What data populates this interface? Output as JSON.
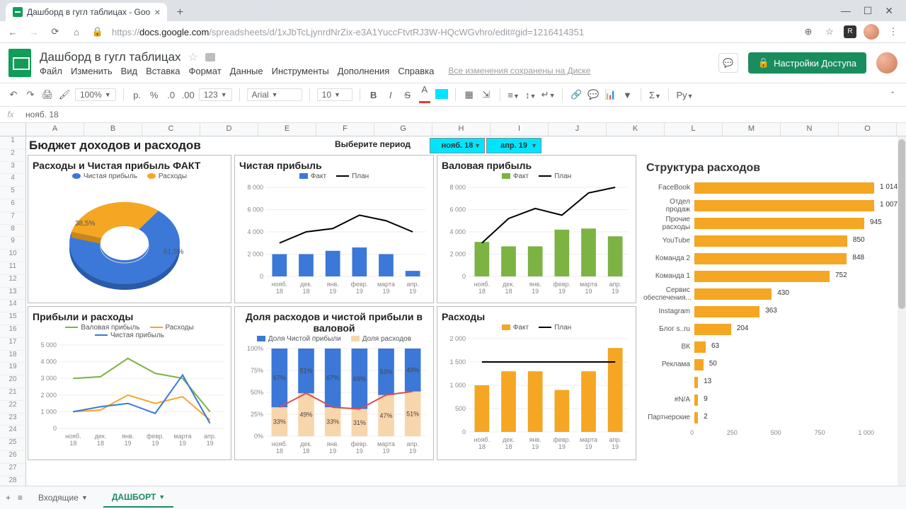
{
  "browser": {
    "tab_title": "Дашборд в гугл таблицах - Goo",
    "new_tab": "+",
    "url_prefix": "https://",
    "url_host": "docs.google.com",
    "url_path": "/spreadsheets/d/1xJbTcLjynrdNrZix-e3A1YuccFtvtRJ3W-HQcWGvhro/edit#gid=1216414351"
  },
  "doc": {
    "title": "Дашборд в гугл таблицах",
    "share": "Настройки Доступа",
    "save_indicator": "Все изменения сохранены на Диске",
    "menu": [
      "Файл",
      "Изменить",
      "Вид",
      "Вставка",
      "Формат",
      "Данные",
      "Инструменты",
      "Дополнения",
      "Справка"
    ]
  },
  "toolbar": {
    "zoom": "100%",
    "currency": "р.",
    "percent": "%",
    "dec_remove": ".0",
    "dec_add": ".00",
    "num_fmt": "123",
    "font": "Arial",
    "font_size": "10",
    "bold": "B",
    "italic": "I",
    "strike": "S",
    "text_color": "A",
    "fill": "▇",
    "script": "Ру"
  },
  "fx": {
    "value": "нояб. 18"
  },
  "columns": [
    "A",
    "B",
    "C",
    "D",
    "E",
    "F",
    "G",
    "H",
    "I",
    "J",
    "K",
    "L",
    "M",
    "N",
    "O"
  ],
  "rows_max": 28,
  "dashboard": {
    "title": "Бюджет доходов и расходов",
    "period_label": "Выберите период",
    "period_from": "нояб. 18",
    "period_to": "апр. 19",
    "categories": [
      "нояб. 18",
      "дек. 18",
      "янв. 19",
      "февр. 19",
      "марта 19",
      "апр. 19"
    ]
  },
  "panels": {
    "donut_title": "Расходы и Чистая прибыль ФАКТ",
    "donut_legend_a": "Чистая прибыль",
    "donut_legend_b": "Расходы",
    "net_title": "Чистая прибыль",
    "gross_title": "Валовая прибыль",
    "legend_fact": "Факт",
    "legend_plan": "План",
    "pl_title": "Прибыли и расходы",
    "pl_legend_gross": "Валовая прибыль",
    "pl_legend_exp": "Расходы",
    "pl_legend_net": "Чистая прибыль",
    "share_title": "Доля расходов и чистой прибыли в валовой",
    "share_legend_net": "Доля Чистой прибыли",
    "share_legend_exp": "Доля расходов",
    "exp_title": "Расходы",
    "struct_title": "Структура расходов"
  },
  "sheet_tabs": {
    "add": "+",
    "all": "≡",
    "tab1": "Входящие",
    "tab2": "ДАШБОРТ"
  },
  "chart_data": [
    {
      "id": "donut",
      "type": "pie",
      "title": "Расходы и Чистая прибыль ФАКТ",
      "series": [
        {
          "name": "Чистая прибыль",
          "value": 61.5,
          "color": "#3b78d8"
        },
        {
          "name": "Расходы",
          "value": 38.5,
          "color": "#f5a623"
        }
      ],
      "labels": [
        "61,5%",
        "38,5%"
      ]
    },
    {
      "id": "net_profit",
      "type": "bar",
      "title": "Чистая прибыль",
      "categories": [
        "нояб. 18",
        "дек. 18",
        "янв. 19",
        "февр. 19",
        "марта 19",
        "апр. 19"
      ],
      "series": [
        {
          "name": "Факт",
          "color": "#3b78d8",
          "values": [
            2000,
            2000,
            2300,
            2600,
            2000,
            500
          ]
        },
        {
          "name": "План",
          "color": "#000",
          "type": "line",
          "values": [
            3000,
            4000,
            4300,
            5500,
            5000,
            4000
          ]
        }
      ],
      "ylabel": "",
      "ylim": [
        0,
        8000
      ],
      "yticks": [
        0,
        2000,
        4000,
        6000,
        8000
      ]
    },
    {
      "id": "gross_profit",
      "type": "bar",
      "title": "Валовая прибыль",
      "categories": [
        "нояб. 18",
        "дек. 18",
        "янв. 19",
        "февр. 19",
        "марта 19",
        "апр. 19"
      ],
      "series": [
        {
          "name": "Факт",
          "color": "#7cb342",
          "values": [
            3100,
            2700,
            2700,
            4200,
            4300,
            3600
          ]
        },
        {
          "name": "План",
          "color": "#000",
          "type": "line",
          "values": [
            3000,
            5200,
            6100,
            5500,
            7500,
            8000
          ]
        }
      ],
      "ylim": [
        0,
        8000
      ],
      "yticks": [
        0,
        2000,
        4000,
        6000,
        8000
      ]
    },
    {
      "id": "pl_lines",
      "type": "line",
      "title": "Прибыли и расходы",
      "categories": [
        "нояб. 18",
        "дек. 18",
        "янв. 19",
        "февр. 19",
        "марта 19",
        "апр. 19"
      ],
      "series": [
        {
          "name": "Валовая прибыль",
          "color": "#7cb342",
          "values": [
            3000,
            3100,
            4200,
            3300,
            3000,
            1000
          ]
        },
        {
          "name": "Расходы",
          "color": "#f5a623",
          "values": [
            1000,
            1100,
            2000,
            1500,
            1900,
            500
          ]
        },
        {
          "name": "Чистая прибыль",
          "color": "#3b78d8",
          "values": [
            1000,
            1300,
            1500,
            900,
            3200,
            300
          ]
        }
      ],
      "ylim": [
        0,
        5000
      ],
      "yticks": [
        0,
        1000,
        2000,
        3000,
        4000,
        5000
      ]
    },
    {
      "id": "share_stack",
      "type": "bar",
      "stacked": true,
      "title": "Доля расходов и чистой прибыли в валовой",
      "categories": [
        "нояб. 18",
        "дек. 18",
        "янв. 19",
        "февр. 19",
        "марта 19",
        "апр. 19"
      ],
      "series": [
        {
          "name": "Доля Чистой прибыли",
          "color": "#3b78d8",
          "values": [
            67,
            51,
            67,
            69,
            53,
            49
          ]
        },
        {
          "name": "Доля расходов",
          "color": "#f8d6ab",
          "values": [
            33,
            49,
            33,
            31,
            47,
            51
          ]
        }
      ],
      "ylim": [
        0,
        100
      ],
      "yticks": [
        0,
        25,
        50,
        75,
        100
      ],
      "yformat": "%",
      "series_labels": [
        [
          67,
          51,
          67,
          69,
          53,
          49
        ],
        [
          33,
          49,
          33,
          31,
          47,
          51
        ]
      ],
      "trend_line": {
        "color": "#d94f4f",
        "values": [
          33,
          49,
          33,
          31,
          47,
          51
        ]
      }
    },
    {
      "id": "expenses_bar",
      "type": "bar",
      "title": "Расходы",
      "categories": [
        "нояб. 18",
        "дек. 18",
        "янв. 19",
        "февр. 19",
        "марта 19",
        "апр. 19"
      ],
      "series": [
        {
          "name": "Факт",
          "color": "#f5a623",
          "values": [
            1000,
            1300,
            1300,
            900,
            1300,
            1800
          ]
        },
        {
          "name": "План",
          "color": "#000",
          "type": "line",
          "values": [
            1500,
            1500,
            1500,
            1500,
            1500,
            1500
          ]
        }
      ],
      "ylim": [
        0,
        2000
      ],
      "yticks": [
        0,
        500,
        1000,
        1500,
        2000
      ]
    },
    {
      "id": "expense_structure",
      "type": "bar",
      "orientation": "horizontal",
      "title": "Структура расходов",
      "categories": [
        "FaceBook",
        "Отдел продаж",
        "Прочие расходы",
        "YouTube",
        "Команда 2",
        "Команда 1",
        "Сервис обеспечения...",
        "Instagram",
        "Блог s..ru",
        "ВК",
        "Реклама",
        "",
        "#N/A",
        "Партнерские"
      ],
      "values": [
        1014,
        1007,
        945,
        850,
        848,
        752,
        430,
        363,
        204,
        63,
        50,
        13,
        9,
        2
      ],
      "xlim": [
        0,
        1000
      ],
      "xticks": [
        0,
        250,
        500,
        750,
        1000
      ],
      "color": "#f5a623"
    }
  ]
}
